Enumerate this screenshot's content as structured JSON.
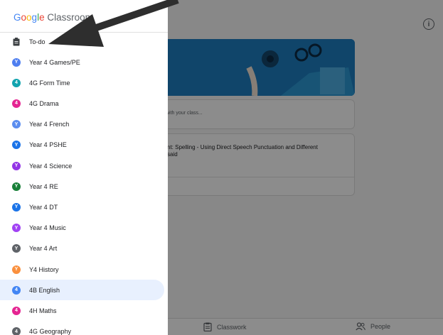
{
  "app": {
    "logo_google": [
      "G",
      "o",
      "o",
      "g",
      "l",
      "e"
    ],
    "logo_product": "Classroom"
  },
  "drawer": {
    "todo_label": "To-do",
    "classes": [
      {
        "label": "Year 4 Games/PE",
        "initial": "Y",
        "color": "#4f7ff0",
        "active": false
      },
      {
        "label": "4G Form Time",
        "initial": "4",
        "color": "#12a4af",
        "active": false
      },
      {
        "label": "4G Drama",
        "initial": "4",
        "color": "#e52592",
        "active": false
      },
      {
        "label": "Year 4 French",
        "initial": "Y",
        "color": "#5b8def",
        "active": false
      },
      {
        "label": "Year 4 PSHE",
        "initial": "Y",
        "color": "#1a73e8",
        "active": false
      },
      {
        "label": "Year 4 Science",
        "initial": "Y",
        "color": "#9334e6",
        "active": false
      },
      {
        "label": "Year 4 RE",
        "initial": "Y",
        "color": "#188038",
        "active": false
      },
      {
        "label": "Year 4 DT",
        "initial": "Y",
        "color": "#1a73e8",
        "active": false
      },
      {
        "label": "Year 4 Music",
        "initial": "Y",
        "color": "#a142f4",
        "active": false
      },
      {
        "label": "Year 4 Art",
        "initial": "Y",
        "color": "#5f6368",
        "active": false
      },
      {
        "label": "Y4 History",
        "initial": "Y",
        "color": "#fa903e",
        "active": false
      },
      {
        "label": "4B English",
        "initial": "4",
        "color": "#4285f4",
        "active": true
      },
      {
        "label": "4H Maths",
        "initial": "4",
        "color": "#e52592",
        "active": false
      },
      {
        "label": "4G Geography",
        "initial": "4",
        "color": "#5f6368",
        "active": false
      }
    ]
  },
  "main": {
    "announce_placeholder": "with your class...",
    "post_title": "nt: Spelling - Using Direct Speech Punctuation and Different\nsaid",
    "info_icon": "i"
  },
  "bottom_nav": {
    "classwork_label": "Classwork",
    "people_label": "People"
  }
}
